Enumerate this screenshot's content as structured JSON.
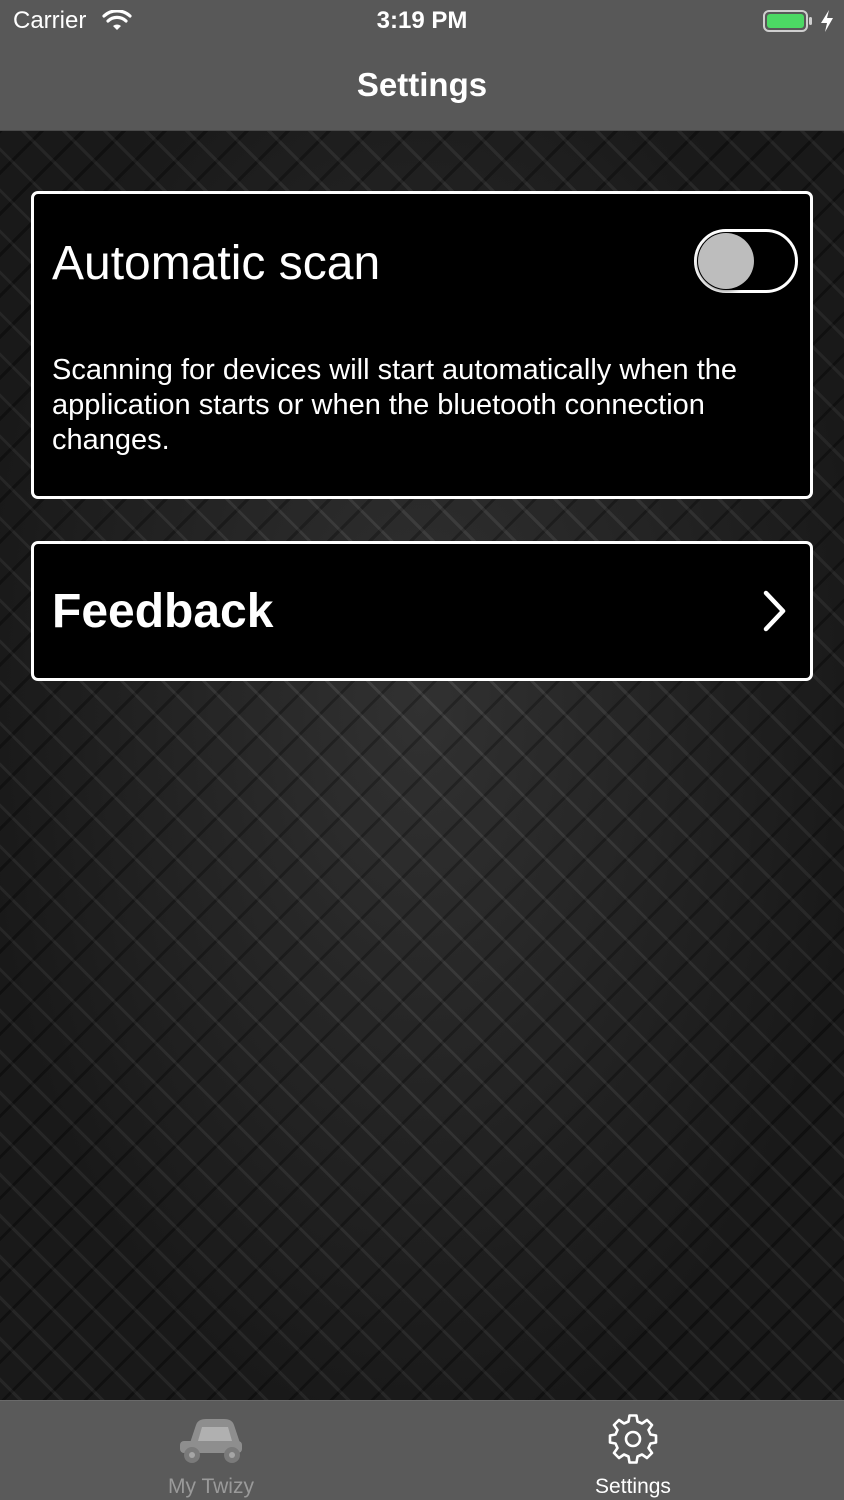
{
  "status_bar": {
    "carrier": "Carrier",
    "time": "3:19 PM",
    "wifi_icon": "wifi-icon",
    "battery_icon": "battery-icon",
    "battery_level": 1.0,
    "battery_color": "#4cd964"
  },
  "nav": {
    "title": "Settings"
  },
  "settings": {
    "automatic_scan": {
      "label": "Automatic scan",
      "enabled": false,
      "description": "Scanning for devices will start automatically when the application starts or when the bluetooth connection changes."
    },
    "feedback": {
      "label": "Feedback",
      "icon": "chevron-right-icon"
    }
  },
  "tab_bar": {
    "tabs": [
      {
        "label": "My Twizy",
        "icon": "car-icon",
        "selected": false
      },
      {
        "label": "Settings",
        "icon": "gear-icon",
        "selected": true
      }
    ]
  }
}
